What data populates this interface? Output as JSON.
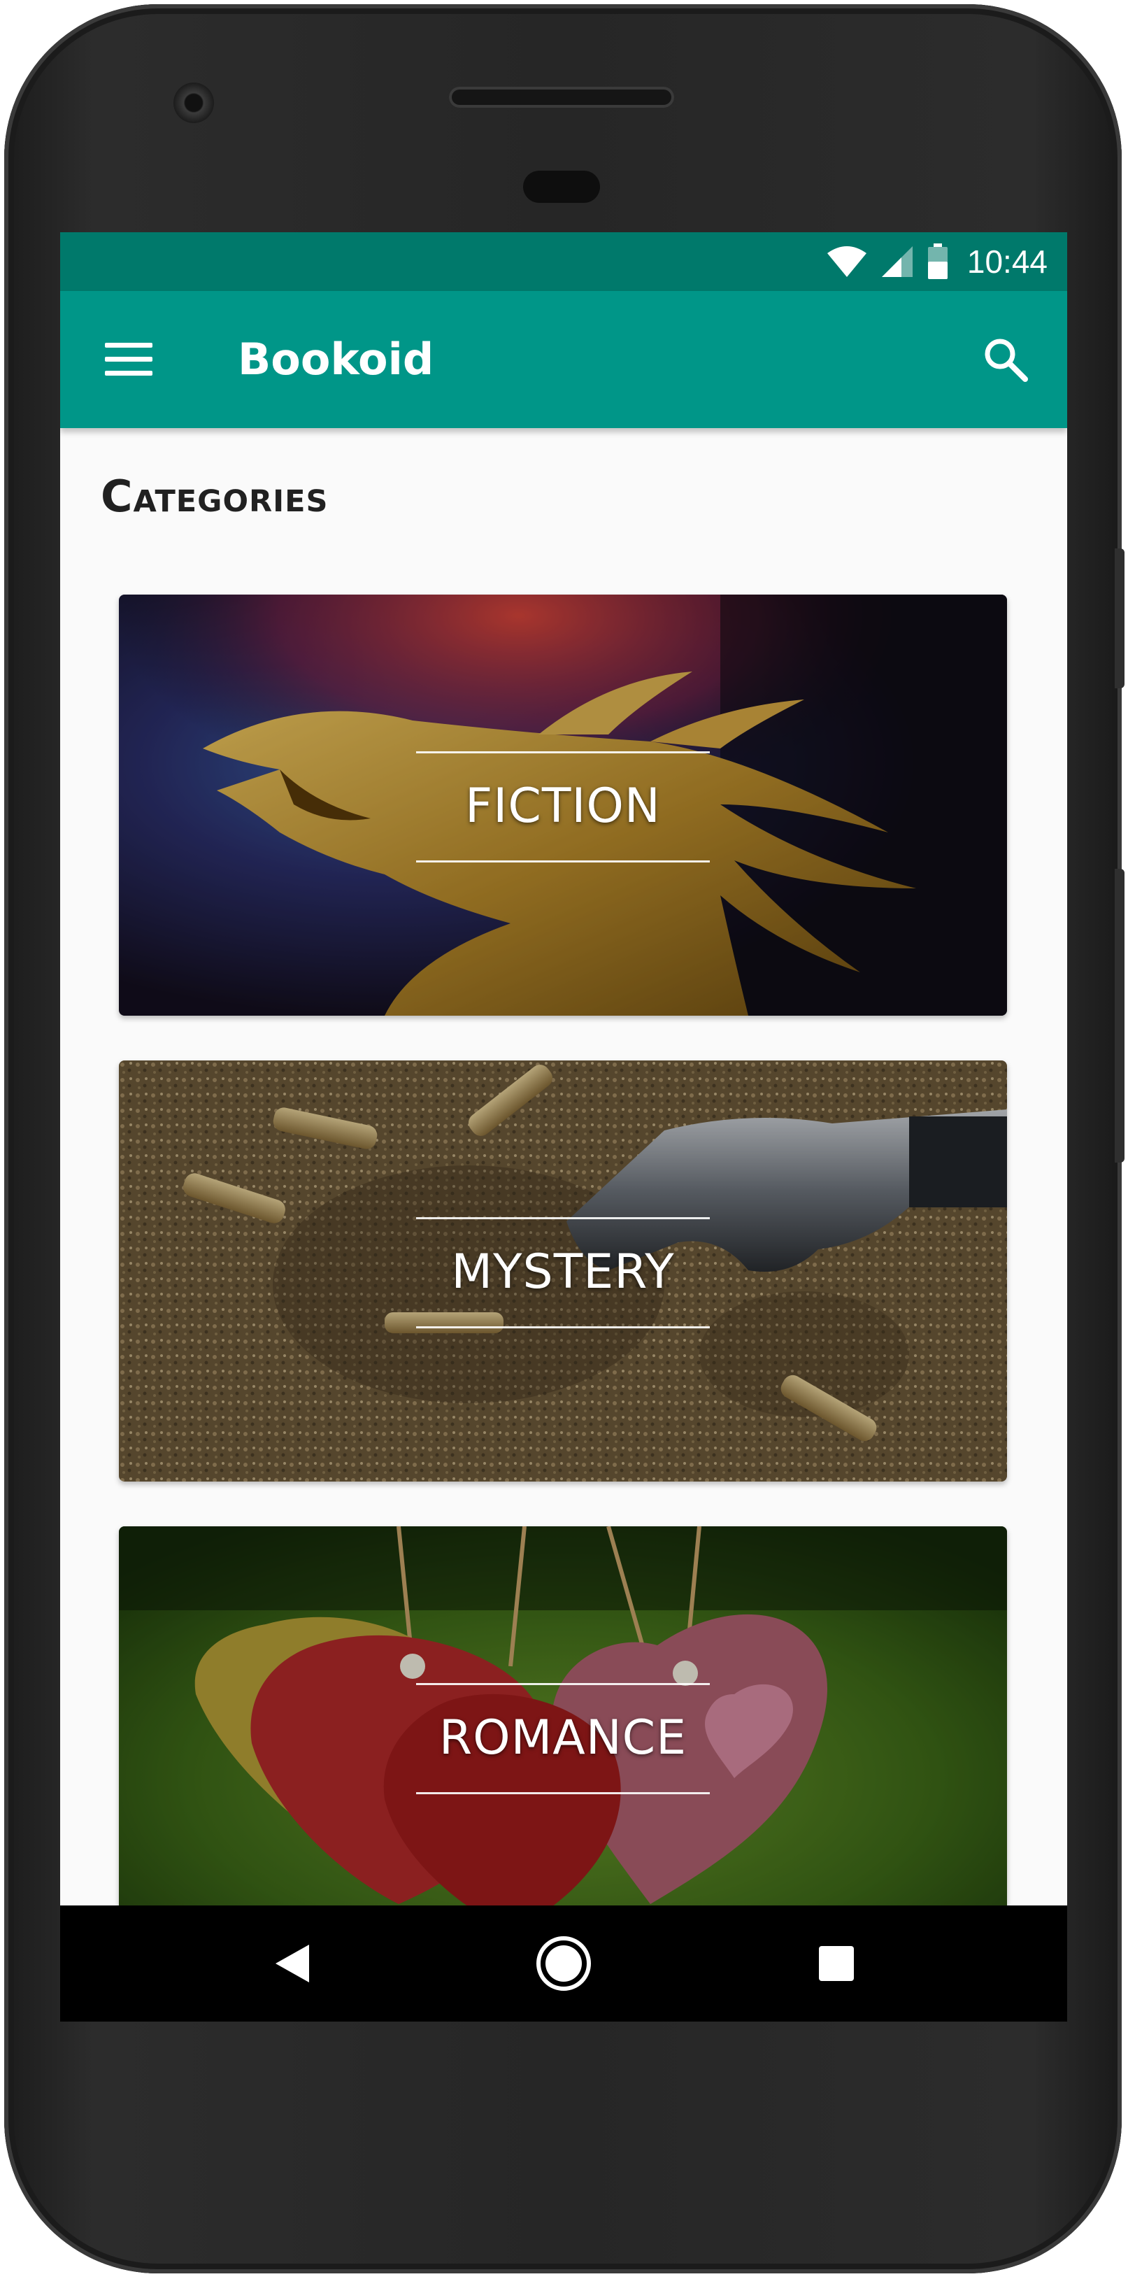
{
  "status_bar": {
    "time": "10:44",
    "icons": [
      "wifi-icon",
      "signal-icon",
      "battery-icon"
    ],
    "background": "#00796b"
  },
  "app_bar": {
    "menu_icon": "menu-icon",
    "title": "Bookoid",
    "search_icon": "search-icon",
    "background": "#009688"
  },
  "main": {
    "section_title": "Categories",
    "categories": [
      {
        "label": "FICTION",
        "image": "golden-dragon-image"
      },
      {
        "label": "MYSTERY",
        "image": "revolver-and-bullets-image"
      },
      {
        "label": "ROMANCE",
        "image": "hanging-hearts-image"
      }
    ]
  },
  "nav_bar": {
    "buttons": [
      "back-icon",
      "home-icon",
      "recents-icon"
    ]
  }
}
